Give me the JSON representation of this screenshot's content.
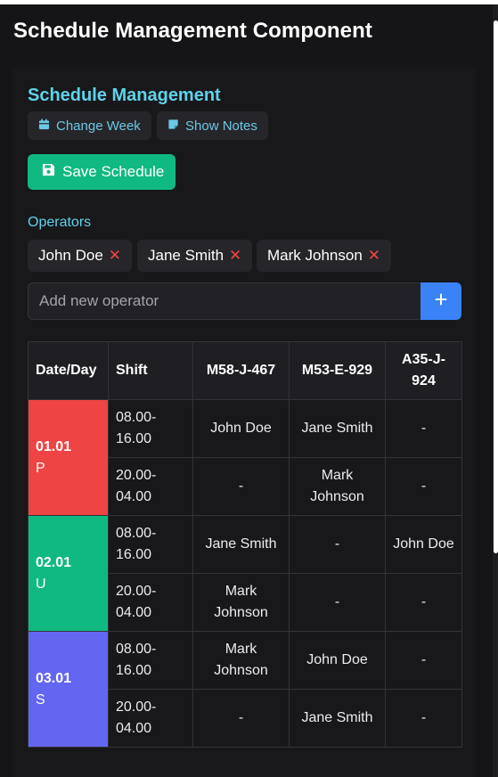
{
  "app": {
    "title": "Schedule Management Component"
  },
  "section": {
    "title": "Schedule Management"
  },
  "controls": {
    "change_week_label": "Change Week",
    "show_notes_label": "Show Notes",
    "save_label": "Save Schedule"
  },
  "operators": {
    "label": "Operators",
    "list": [
      {
        "name": "John Doe",
        "remove": "✕"
      },
      {
        "name": "Jane Smith",
        "remove": "✕"
      },
      {
        "name": "Mark Johnson",
        "remove": "✕"
      }
    ],
    "add_placeholder": "Add new operator",
    "add_value": ""
  },
  "colors": {
    "accent_cyan": "#5fd3ea",
    "save_green": "#10b981",
    "add_blue": "#3b82f6",
    "remove_red": "#ef4444",
    "day_colors": [
      "#ef4444",
      "#10b981",
      "#6366f1"
    ]
  },
  "table": {
    "headers": [
      "Date/Day",
      "Shift",
      "M58-J-467",
      "M53-E-929",
      "A35-J-924"
    ],
    "days": [
      {
        "date": "01.01",
        "letter": "P",
        "rows": [
          {
            "shift": "08.00-16.00",
            "cells": [
              "John Doe",
              "Jane Smith",
              "-"
            ]
          },
          {
            "shift": "20.00-04.00",
            "cells": [
              "-",
              "Mark Johnson",
              "-"
            ]
          }
        ]
      },
      {
        "date": "02.01",
        "letter": "U",
        "rows": [
          {
            "shift": "08.00-16.00",
            "cells": [
              "Jane Smith",
              "-",
              "John Doe"
            ]
          },
          {
            "shift": "20.00-04.00",
            "cells": [
              "Mark Johnson",
              "-",
              "-"
            ]
          }
        ]
      },
      {
        "date": "03.01",
        "letter": "S",
        "rows": [
          {
            "shift": "08.00-16.00",
            "cells": [
              "Mark Johnson",
              "John Doe",
              "-"
            ]
          },
          {
            "shift": "20.00-04.00",
            "cells": [
              "-",
              "Jane Smith",
              "-"
            ]
          }
        ]
      }
    ]
  }
}
